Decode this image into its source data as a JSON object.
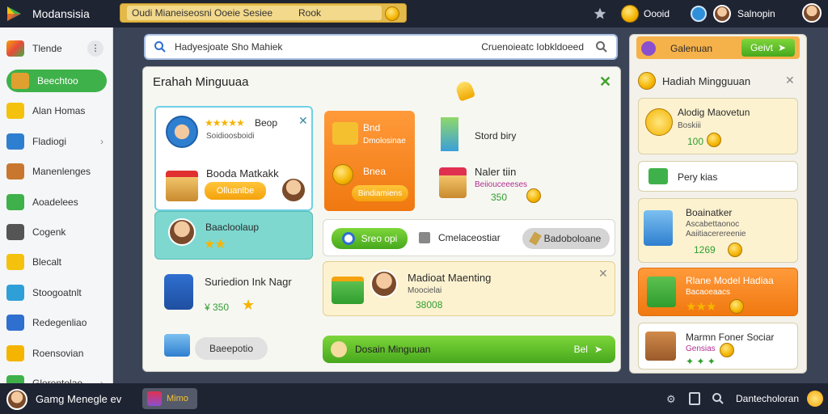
{
  "topbar": {
    "app_name": "Modansisia",
    "search_text": "Oudi Mianeiseosni Ooeie Sesiee",
    "search_tag": "Rook",
    "coins_label": "Oooid",
    "profile_label": "Salnopin"
  },
  "sidebar": {
    "header": "Tlende",
    "items": [
      {
        "label": "Beechtoo",
        "icon": "box-icon",
        "active": true
      },
      {
        "label": "Alan Homas",
        "icon": "star-icon"
      },
      {
        "label": "Fladiogi",
        "icon": "chart-icon",
        "chevron": true
      },
      {
        "label": "Manenlenges",
        "icon": "hammer-icon"
      },
      {
        "label": "Aoadelees",
        "icon": "grid-icon"
      },
      {
        "label": "Cogenk",
        "icon": "arrow-icon"
      },
      {
        "label": "Blecalt",
        "icon": "star-icon"
      },
      {
        "label": "Stoogoatnlt",
        "icon": "gems-icon"
      },
      {
        "label": "Redegenliao",
        "icon": "shield-icon"
      },
      {
        "label": "Roensovian",
        "icon": "coins-icon"
      },
      {
        "label": "Glerentolao",
        "icon": "money-icon",
        "chevron": true
      }
    ]
  },
  "search": {
    "placeholder": "Hadyesjoate Sho Mahiek",
    "right_text": "Cruenoieatc Iobkldoeed"
  },
  "panel": {
    "title": "Erahah Minguuaa",
    "card1": {
      "rating_label": "Beop",
      "subtitle": "Soidioosboidi"
    },
    "card2": {
      "title": "Booda Matkakk",
      "button": "Olluanlbe"
    },
    "card3": {
      "title": "Baacloolaup"
    },
    "card4": {
      "title": "Suriedion Ink Nagr",
      "value": "¥ 350"
    },
    "card5": {
      "button": "Baeepotio"
    },
    "orange_card": {
      "label1": "Bnd",
      "sub1": "Dmolosinae",
      "label2": "Bnea",
      "button": "Bindiamiens"
    },
    "stand": {
      "label": "Stord biry"
    },
    "gift": {
      "title": "Naler tiin",
      "sub": "Beiiouceeeses",
      "value": "350"
    },
    "toolbar": {
      "green_button": "Sreo opi",
      "middle": "Cmelaceostiar",
      "gray_button": "Badoboloane"
    },
    "reward": {
      "title": "Madioat Maenting",
      "sub": "Moocielai",
      "value": "38008"
    },
    "footer": {
      "label": "Dosain Minguuan",
      "button": "Bel"
    }
  },
  "rpanel": {
    "header_label": "Galenuan",
    "header_button": "Geivt",
    "title": "Hadiah Mingguuan",
    "items": [
      {
        "title": "Alodig Maovetun",
        "sub": "Boskiii",
        "value": "100"
      },
      {
        "title": "Pery kias"
      },
      {
        "title": "Boainatker",
        "sub": "Ascabettaonoc",
        "sub2": "Aaiitiacerereenie",
        "value": "1269"
      },
      {
        "title": "Rlane Model Hadiaa",
        "sub": "Bacaoeaacs"
      },
      {
        "title": "Marmn Foner Sociar",
        "sub": "Gensias"
      }
    ]
  },
  "bottombar": {
    "user_label": "Gamg Menegle ev",
    "badge": "Mimo",
    "right_text": "Dantecholoran"
  },
  "colors": {
    "accent_green": "#47a81d",
    "accent_orange": "#f4a20d",
    "topbar": "#1f2433"
  }
}
